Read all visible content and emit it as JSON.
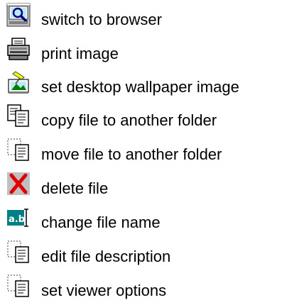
{
  "items": [
    {
      "label": "switch to browser",
      "icon": "browser-icon"
    },
    {
      "label": "print image",
      "icon": "printer-icon"
    },
    {
      "label": "set desktop wallpaper image",
      "icon": "wallpaper-icon"
    },
    {
      "label": "copy file to another folder",
      "icon": "copy-file-icon"
    },
    {
      "label": "move file to another folder",
      "icon": "move-file-icon"
    },
    {
      "label": "delete file",
      "icon": "delete-icon"
    },
    {
      "label": "change file name",
      "icon": "rename-icon"
    },
    {
      "label": "edit file description",
      "icon": "edit-description-icon"
    },
    {
      "label": "set viewer options",
      "icon": "options-icon"
    }
  ],
  "colors": {
    "text": "#000000",
    "icon_gray": "#c0c0c0",
    "icon_dark": "#808080",
    "delete_red": "#e00000",
    "rename_teal": "#008080"
  }
}
